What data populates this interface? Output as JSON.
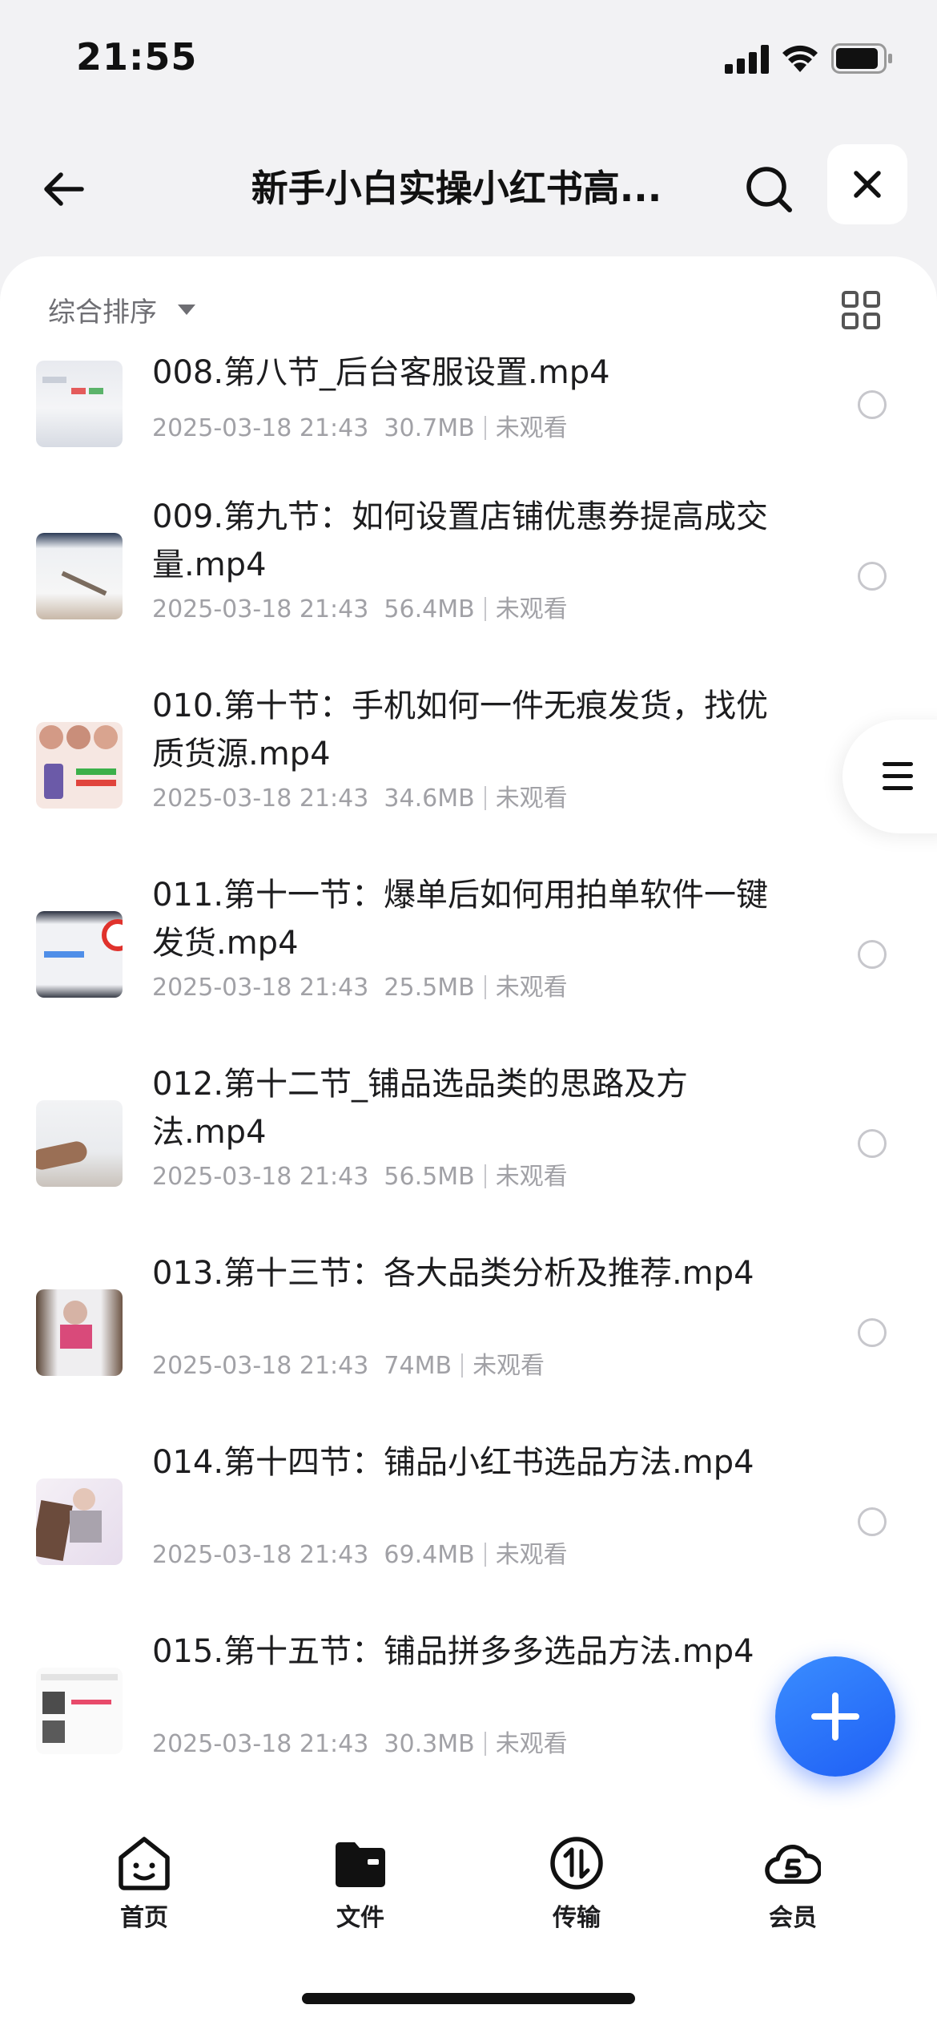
{
  "status_bar": {
    "time": "21:55"
  },
  "header": {
    "title": "新手小白实操小红书高..."
  },
  "sort": {
    "label": "综合排序"
  },
  "files": [
    {
      "name": "008.第八节_后台客服设置.mp4",
      "date": "2025-03-18 21:43",
      "size": "30.7MB",
      "status": "未观看"
    },
    {
      "name": "009.第九节：如何设置店铺优惠券提高成交量.mp4",
      "date": "2025-03-18 21:43",
      "size": "56.4MB",
      "status": "未观看"
    },
    {
      "name": "010.第十节：手机如何一件无痕发货，找优质货源.mp4",
      "date": "2025-03-18 21:43",
      "size": "34.6MB",
      "status": "未观看"
    },
    {
      "name": "011.第十一节：爆单后如何用拍单软件一键发货.mp4",
      "date": "2025-03-18 21:43",
      "size": "25.5MB",
      "status": "未观看"
    },
    {
      "name": "012.第十二节_铺品选品类的思路及方法.mp4",
      "date": "2025-03-18 21:43",
      "size": "56.5MB",
      "status": "未观看"
    },
    {
      "name": "013.第十三节：各大品类分析及推荐.mp4",
      "date": "2025-03-18 21:43",
      "size": "74MB",
      "status": "未观看"
    },
    {
      "name": "014.第十四节：铺品小红书选品方法.mp4",
      "date": "2025-03-18 21:43",
      "size": "69.4MB",
      "status": "未观看"
    },
    {
      "name": "015.第十五节：铺品拼多多选品方法.mp4",
      "date": "2025-03-18 21:43",
      "size": "30.3MB",
      "status": "未观看"
    }
  ],
  "tabs": [
    {
      "label": "首页",
      "icon": "home-smile-icon"
    },
    {
      "label": "文件",
      "icon": "folder-icon"
    },
    {
      "label": "传输",
      "icon": "transfer-icon"
    },
    {
      "label": "会员",
      "icon": "vip-cloud-icon"
    }
  ],
  "colors": {
    "accent": "#2a6ff8",
    "text": "#1d1d1f",
    "meta": "#a1a1a6"
  }
}
